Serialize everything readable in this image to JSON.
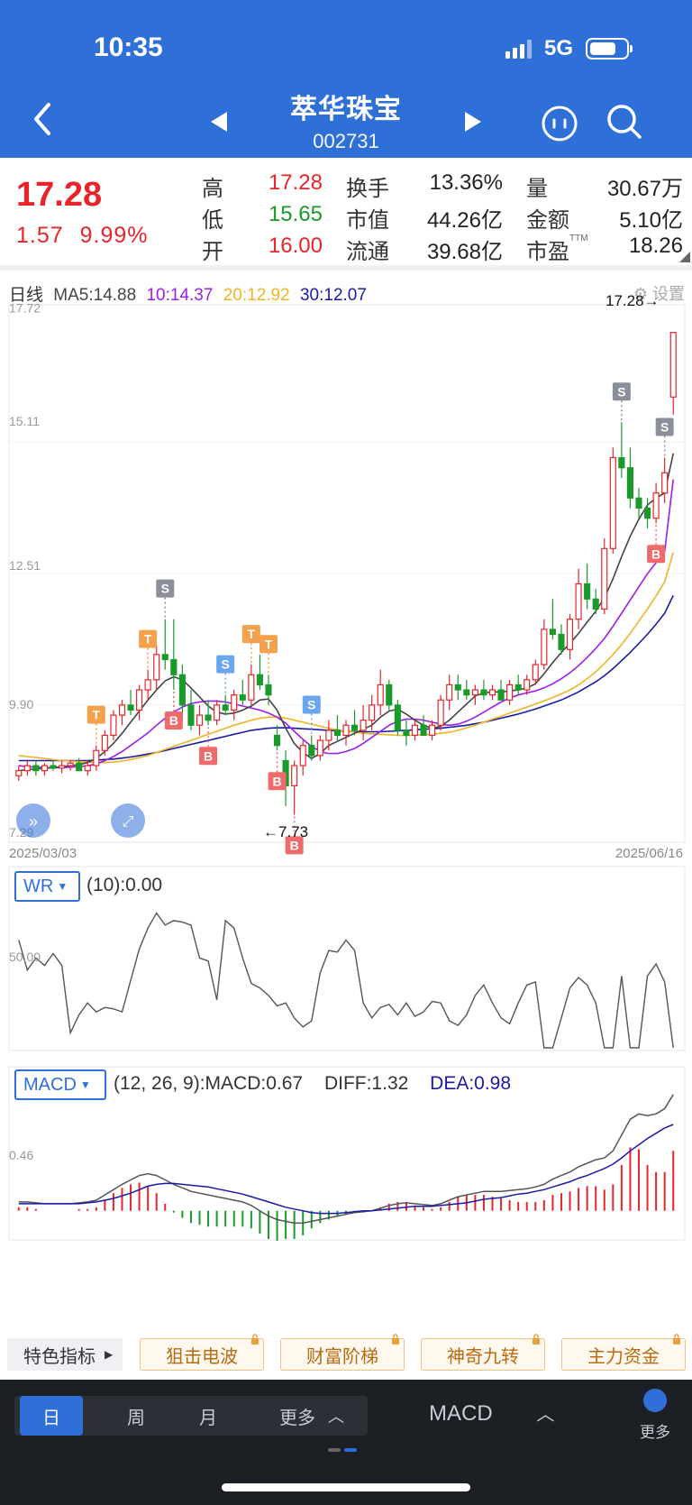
{
  "status": {
    "time": "10:35",
    "network": "5G"
  },
  "stock": {
    "name": "萃华珠宝",
    "code": "002731"
  },
  "quote": {
    "price": "17.28",
    "change": "1.57",
    "change_pct": "9.99%",
    "rows": [
      [
        {
          "label": "高",
          "value": "17.28",
          "color": "red"
        },
        {
          "label": "换手",
          "value": "13.36%"
        },
        {
          "label": "量",
          "value": "30.67万"
        }
      ],
      [
        {
          "label": "低",
          "value": "15.65",
          "color": "green"
        },
        {
          "label": "市值",
          "value": "44.26亿"
        },
        {
          "label": "金额",
          "value": "5.10亿"
        }
      ],
      [
        {
          "label": "开",
          "value": "16.00",
          "color": "red"
        },
        {
          "label": "流通",
          "value": "39.68亿"
        },
        {
          "label": "市盈",
          "value": "18.26",
          "sup": "TTM"
        }
      ]
    ]
  },
  "ma_legend": {
    "period": "日线",
    "ma5": "MA5:14.88",
    "ma10": "10:14.37",
    "ma20": "20:12.92",
    "ma30": "30:12.07",
    "settings": "设置"
  },
  "price_chart": {
    "y_labels": [
      "17.72",
      "15.11",
      "12.51",
      "9.90",
      "7.29"
    ],
    "start_date": "2025/03/03",
    "end_date": "2025/06/16",
    "high_marker": "17.28→",
    "low_marker": "←7.73"
  },
  "wr": {
    "button": "WR",
    "text": "(10):0.00",
    "y_label": "50.00"
  },
  "macd": {
    "button": "MACD",
    "params": "(12, 26, 9):MACD:0.67",
    "diff": "DIFF:1.32",
    "dea": "DEA:0.98",
    "y_label": "0.46"
  },
  "features": {
    "first": "特色指标",
    "buttons": [
      "狙击电波",
      "财富阶梯",
      "神奇九转",
      "主力资金"
    ]
  },
  "bottom": {
    "periods": [
      "日",
      "周",
      "月",
      "更多"
    ],
    "indicator": "MACD",
    "more": "更多"
  },
  "colors": {
    "brand": "#2f6fd8",
    "up": "#e8242a",
    "down": "#1a9a2a",
    "ma5": "#444444",
    "ma10": "#9b1fe8",
    "ma20": "#f0b323",
    "ma30": "#1a1aa6"
  },
  "chart_data": [
    {
      "type": "candlestick",
      "x_range": [
        "2025/03/03",
        "2025/06/16"
      ],
      "ylim": [
        7.29,
        17.72
      ],
      "candles": [
        [
          8.5,
          8.7,
          8.4,
          8.6
        ],
        [
          8.6,
          8.8,
          8.5,
          8.7
        ],
        [
          8.7,
          8.8,
          8.5,
          8.6
        ],
        [
          8.6,
          8.75,
          8.5,
          8.7
        ],
        [
          8.7,
          8.8,
          8.6,
          8.65
        ],
        [
          8.65,
          8.8,
          8.55,
          8.7
        ],
        [
          8.7,
          8.8,
          8.6,
          8.75
        ],
        [
          8.75,
          8.85,
          8.6,
          8.6
        ],
        [
          8.6,
          8.8,
          8.5,
          8.7
        ],
        [
          8.7,
          9.1,
          8.6,
          9.0
        ],
        [
          9.0,
          9.4,
          8.9,
          9.3
        ],
        [
          9.3,
          9.8,
          9.2,
          9.7
        ],
        [
          9.7,
          10.0,
          9.5,
          9.9
        ],
        [
          9.9,
          10.2,
          9.7,
          9.8
        ],
        [
          9.8,
          10.3,
          9.6,
          10.2
        ],
        [
          10.2,
          10.6,
          10.0,
          10.4
        ],
        [
          10.4,
          11.1,
          10.2,
          10.9
        ],
        [
          10.9,
          11.6,
          10.6,
          10.8
        ],
        [
          10.8,
          11.6,
          10.2,
          10.5
        ],
        [
          10.5,
          10.7,
          9.6,
          9.9
        ],
        [
          9.9,
          10.2,
          9.4,
          9.5
        ],
        [
          9.5,
          9.9,
          9.3,
          9.7
        ],
        [
          9.7,
          10.0,
          9.5,
          9.6
        ],
        [
          9.6,
          10.0,
          9.5,
          9.9
        ],
        [
          9.9,
          10.1,
          9.7,
          9.8
        ],
        [
          9.8,
          10.2,
          9.6,
          10.1
        ],
        [
          10.1,
          10.4,
          9.9,
          10.0
        ],
        [
          10.0,
          10.7,
          9.9,
          10.5
        ],
        [
          10.5,
          10.9,
          10.2,
          10.3
        ],
        [
          10.3,
          10.5,
          9.9,
          10.1
        ],
        [
          9.3,
          9.5,
          9.0,
          9.1
        ],
        [
          8.8,
          9.0,
          7.9,
          8.3
        ],
        [
          8.3,
          8.8,
          7.73,
          8.7
        ],
        [
          8.7,
          9.2,
          8.5,
          9.1
        ],
        [
          9.1,
          9.3,
          8.8,
          8.9
        ],
        [
          8.9,
          9.3,
          8.8,
          9.2
        ],
        [
          9.2,
          9.6,
          9.0,
          9.4
        ],
        [
          9.4,
          9.7,
          9.2,
          9.3
        ],
        [
          9.3,
          9.6,
          9.1,
          9.5
        ],
        [
          9.5,
          9.8,
          9.3,
          9.4
        ],
        [
          9.4,
          9.9,
          9.2,
          9.6
        ],
        [
          9.6,
          10.1,
          9.4,
          9.9
        ],
        [
          9.9,
          10.6,
          9.7,
          10.3
        ],
        [
          10.3,
          10.4,
          9.8,
          9.9
        ],
        [
          9.9,
          10.0,
          9.3,
          9.4
        ],
        [
          9.4,
          9.6,
          9.1,
          9.3
        ],
        [
          9.3,
          9.6,
          9.2,
          9.5
        ],
        [
          9.5,
          9.7,
          9.3,
          9.3
        ],
        [
          9.3,
          9.6,
          9.2,
          9.5
        ],
        [
          9.5,
          10.1,
          9.4,
          10.0
        ],
        [
          10.0,
          10.5,
          9.8,
          10.3
        ],
        [
          10.3,
          10.5,
          10.0,
          10.2
        ],
        [
          10.2,
          10.4,
          10.0,
          10.1
        ],
        [
          10.1,
          10.3,
          9.9,
          10.2
        ],
        [
          10.2,
          10.4,
          10.0,
          10.1
        ],
        [
          10.1,
          10.3,
          10.0,
          10.2
        ],
        [
          10.2,
          10.4,
          10.0,
          10.0
        ],
        [
          10.0,
          10.4,
          9.9,
          10.3
        ],
        [
          10.3,
          10.5,
          10.1,
          10.2
        ],
        [
          10.2,
          10.5,
          10.1,
          10.4
        ],
        [
          10.4,
          10.8,
          10.3,
          10.7
        ],
        [
          10.7,
          11.6,
          10.6,
          11.4
        ],
        [
          11.4,
          12.0,
          11.2,
          11.3
        ],
        [
          11.3,
          11.5,
          10.9,
          11.0
        ],
        [
          11.0,
          11.7,
          10.8,
          11.6
        ],
        [
          11.6,
          12.6,
          11.4,
          12.3
        ],
        [
          12.3,
          12.7,
          11.8,
          12.0
        ],
        [
          12.0,
          12.2,
          11.7,
          11.8
        ],
        [
          11.8,
          13.2,
          11.7,
          13.0
        ],
        [
          13.0,
          15.0,
          12.9,
          14.8
        ],
        [
          14.8,
          15.5,
          14.4,
          14.6
        ],
        [
          14.6,
          15.0,
          13.8,
          14.0
        ],
        [
          14.0,
          14.2,
          13.6,
          13.8
        ],
        [
          13.8,
          14.0,
          13.4,
          13.6
        ],
        [
          13.6,
          14.3,
          13.5,
          14.1
        ],
        [
          14.1,
          14.8,
          13.9,
          14.5
        ],
        [
          16.0,
          17.28,
          15.65,
          17.28
        ]
      ],
      "ma": {
        "ma5": [
          8.6,
          8.62,
          8.63,
          8.65,
          8.66,
          8.68,
          8.7,
          8.72,
          8.76,
          8.84,
          8.98,
          9.14,
          9.34,
          9.56,
          9.78,
          10.0,
          10.2,
          10.38,
          10.46,
          10.4,
          10.24,
          10.06,
          9.88,
          9.76,
          9.72,
          9.74,
          9.8,
          9.88,
          10.0,
          10.02,
          9.8,
          9.44,
          9.14,
          8.96,
          8.84,
          8.94,
          9.1,
          9.18,
          9.26,
          9.34,
          9.42,
          9.5,
          9.66,
          9.78,
          9.82,
          9.72,
          9.6,
          9.5,
          9.44,
          9.48,
          9.6,
          9.76,
          9.92,
          10.08,
          10.14,
          10.16,
          10.16,
          10.18,
          10.2,
          10.24,
          10.32,
          10.52,
          10.74,
          10.94,
          11.12,
          11.32,
          11.54,
          11.76,
          12.02,
          12.4,
          12.84,
          13.24,
          13.58,
          13.86,
          14.0,
          14.1,
          14.88
        ],
        "ma10": [
          8.7,
          8.68,
          8.67,
          8.66,
          8.66,
          8.66,
          8.67,
          8.68,
          8.7,
          8.73,
          8.8,
          8.88,
          8.98,
          9.1,
          9.22,
          9.35,
          9.5,
          9.64,
          9.76,
          9.86,
          9.93,
          9.96,
          9.98,
          9.98,
          9.96,
          9.92,
          9.88,
          9.84,
          9.8,
          9.74,
          9.66,
          9.54,
          9.38,
          9.22,
          9.08,
          8.98,
          8.94,
          8.94,
          8.98,
          9.04,
          9.14,
          9.26,
          9.38,
          9.5,
          9.58,
          9.62,
          9.62,
          9.6,
          9.56,
          9.52,
          9.5,
          9.52,
          9.58,
          9.66,
          9.76,
          9.86,
          9.96,
          10.04,
          10.1,
          10.14,
          10.18,
          10.24,
          10.32,
          10.42,
          10.54,
          10.68,
          10.84,
          11.02,
          11.22,
          11.46,
          11.72,
          11.98,
          12.24,
          12.5,
          12.72,
          12.94,
          14.37
        ],
        "ma20": [
          8.9,
          8.88,
          8.86,
          8.84,
          8.82,
          8.8,
          8.79,
          8.78,
          8.77,
          8.76,
          8.76,
          8.77,
          8.79,
          8.82,
          8.86,
          8.9,
          8.96,
          9.02,
          9.08,
          9.14,
          9.2,
          9.26,
          9.32,
          9.38,
          9.44,
          9.5,
          9.55,
          9.6,
          9.64,
          9.66,
          9.66,
          9.64,
          9.6,
          9.56,
          9.52,
          9.48,
          9.44,
          9.41,
          9.38,
          9.36,
          9.34,
          9.33,
          9.32,
          9.31,
          9.3,
          9.3,
          9.3,
          9.31,
          9.32,
          9.34,
          9.36,
          9.4,
          9.45,
          9.5,
          9.56,
          9.62,
          9.68,
          9.74,
          9.8,
          9.86,
          9.92,
          9.98,
          10.05,
          10.12,
          10.2,
          10.3,
          10.42,
          10.56,
          10.72,
          10.9,
          11.1,
          11.32,
          11.56,
          11.8,
          12.06,
          12.34,
          12.92
        ],
        "ma30": [
          8.8,
          8.8,
          8.8,
          8.8,
          8.8,
          8.8,
          8.8,
          8.8,
          8.8,
          8.81,
          8.82,
          8.83,
          8.85,
          8.87,
          8.9,
          8.93,
          8.96,
          9.0,
          9.04,
          9.08,
          9.12,
          9.16,
          9.2,
          9.24,
          9.28,
          9.32,
          9.36,
          9.4,
          9.42,
          9.44,
          9.45,
          9.45,
          9.44,
          9.43,
          9.42,
          9.41,
          9.4,
          9.39,
          9.38,
          9.37,
          9.37,
          9.37,
          9.37,
          9.38,
          9.39,
          9.4,
          9.41,
          9.42,
          9.43,
          9.44,
          9.46,
          9.48,
          9.5,
          9.53,
          9.56,
          9.6,
          9.64,
          9.68,
          9.72,
          9.77,
          9.82,
          9.88,
          9.94,
          10.0,
          10.08,
          10.16,
          10.26,
          10.36,
          10.48,
          10.62,
          10.78,
          10.94,
          11.12,
          11.3,
          11.5,
          11.72,
          12.07
        ]
      },
      "signals": [
        {
          "label": "T",
          "index": 9,
          "dir": "up"
        },
        {
          "label": "S",
          "index": 17,
          "dir": "up"
        },
        {
          "label": "T",
          "index": 15,
          "dir": "up"
        },
        {
          "label": "B",
          "index": 18,
          "dir": "down"
        },
        {
          "label": "B",
          "index": 22,
          "dir": "down"
        },
        {
          "label": "S",
          "index": 24,
          "dir": "up"
        },
        {
          "label": "T",
          "index": 27,
          "dir": "up"
        },
        {
          "label": "T",
          "index": 29,
          "dir": "up"
        },
        {
          "label": "B",
          "index": 30,
          "dir": "down"
        },
        {
          "label": "S",
          "index": 34,
          "dir": "up"
        },
        {
          "label": "B",
          "index": 32,
          "dir": "down"
        },
        {
          "label": "S",
          "index": 70,
          "dir": "up"
        },
        {
          "label": "S",
          "index": 75,
          "dir": "up"
        },
        {
          "label": "B",
          "index": 74,
          "dir": "down"
        }
      ]
    },
    {
      "type": "line",
      "name": "WR(10)",
      "ylim": [
        0,
        100
      ],
      "values": [
        72,
        52,
        60,
        55,
        63,
        55,
        10,
        22,
        30,
        24,
        27,
        26,
        24,
        45,
        66,
        80,
        90,
        82,
        85,
        84,
        82,
        60,
        58,
        32,
        85,
        80,
        60,
        43,
        40,
        35,
        28,
        30,
        20,
        14,
        18,
        50,
        65,
        64,
        72,
        65,
        30,
        20,
        27,
        29,
        22,
        30,
        21,
        24,
        31,
        30,
        18,
        15,
        22,
        35,
        42,
        30,
        20,
        16,
        30,
        42,
        44,
        0,
        0,
        20,
        40,
        47,
        42,
        30,
        0,
        0,
        48,
        0,
        0,
        48,
        56,
        44,
        0
      ]
    },
    {
      "type": "line",
      "name": "MACD",
      "params": "(12, 26, 9)",
      "series": [
        {
          "name": "DIFF",
          "values": [
            0.1,
            0.1,
            0.09,
            0.08,
            0.08,
            0.08,
            0.08,
            0.09,
            0.1,
            0.12,
            0.18,
            0.24,
            0.3,
            0.35,
            0.4,
            0.42,
            0.4,
            0.35,
            0.3,
            0.26,
            0.22,
            0.2,
            0.18,
            0.16,
            0.14,
            0.12,
            0.1,
            0.06,
            0.0,
            -0.06,
            -0.1,
            -0.12,
            -0.14,
            -0.14,
            -0.12,
            -0.1,
            -0.08,
            -0.06,
            -0.04,
            -0.02,
            -0.01,
            0.0,
            0.03,
            0.06,
            0.08,
            0.09,
            0.08,
            0.07,
            0.06,
            0.08,
            0.12,
            0.16,
            0.18,
            0.2,
            0.22,
            0.22,
            0.22,
            0.23,
            0.24,
            0.25,
            0.27,
            0.3,
            0.36,
            0.4,
            0.44,
            0.5,
            0.54,
            0.58,
            0.6,
            0.68,
            0.86,
            1.04,
            1.1,
            1.08,
            1.1,
            1.16,
            1.32
          ]
        },
        {
          "name": "DEA",
          "values": [
            0.08,
            0.08,
            0.08,
            0.08,
            0.08,
            0.08,
            0.08,
            0.08,
            0.09,
            0.1,
            0.12,
            0.14,
            0.17,
            0.2,
            0.24,
            0.28,
            0.3,
            0.31,
            0.31,
            0.3,
            0.29,
            0.28,
            0.27,
            0.25,
            0.23,
            0.21,
            0.19,
            0.16,
            0.13,
            0.1,
            0.07,
            0.04,
            0.02,
            0.0,
            -0.02,
            -0.03,
            -0.03,
            -0.03,
            -0.02,
            -0.01,
            0.0,
            0.0,
            0.01,
            0.02,
            0.03,
            0.04,
            0.05,
            0.05,
            0.05,
            0.06,
            0.07,
            0.08,
            0.09,
            0.11,
            0.13,
            0.14,
            0.15,
            0.17,
            0.19,
            0.2,
            0.22,
            0.24,
            0.27,
            0.3,
            0.33,
            0.37,
            0.4,
            0.44,
            0.48,
            0.53,
            0.6,
            0.68,
            0.75,
            0.82,
            0.88,
            0.94,
            0.98
          ]
        }
      ]
    }
  ]
}
